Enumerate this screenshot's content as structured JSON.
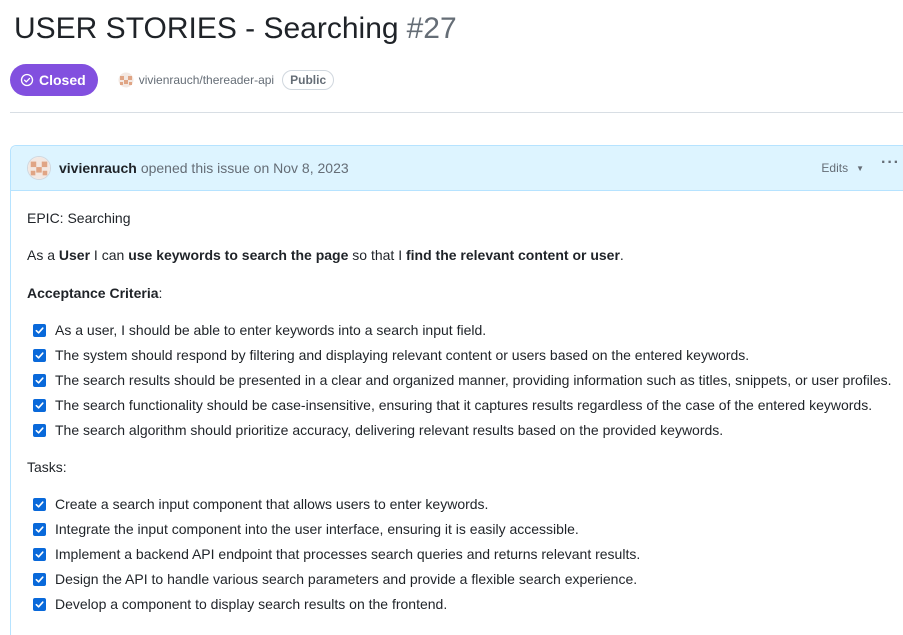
{
  "issue": {
    "title": "USER STORIES - Searching",
    "number": "#27",
    "state_label": "Closed",
    "repo": "vivienrauch/thereader-api",
    "visibility": "Public"
  },
  "comment": {
    "author": "vivienrauch",
    "opened_text": "opened this issue on Nov 8, 2023",
    "edits_label": "Edits",
    "more_label": "···",
    "epic": "EPIC: Searching",
    "story": {
      "p1": "As a ",
      "role": "User",
      "p2": " I can ",
      "action": "use keywords to search the page",
      "p3": " so that I ",
      "benefit": "find the relevant content or user",
      "p4": "."
    },
    "acceptance_heading": "Acceptance Criteria",
    "acceptance_colon": ":",
    "acceptance": [
      "As a user, I should be able to enter keywords into a search input field.",
      "The system should respond by filtering and displaying relevant content or users based on the entered keywords.",
      "The search results should be presented in a clear and organized manner, providing information such as titles, snippets, or user profiles.",
      "The search functionality should be case-insensitive, ensuring that it captures results regardless of the case of the entered keywords.",
      "The search algorithm should prioritize accuracy, delivering relevant results based on the provided keywords."
    ],
    "tasks_heading": "Tasks:",
    "tasks": [
      "Create a search input component that allows users to enter keywords.",
      "Integrate the input component into the user interface, ensuring it is easily accessible.",
      "Implement a backend API endpoint that processes search queries and returns relevant results.",
      "Design the API to handle various search parameters and provide a flexible search experience.",
      "Develop a component to display search results on the frontend."
    ]
  },
  "colors": {
    "closed": "#8250df",
    "checkbox": "#0969da",
    "header_bg": "#ddf4ff"
  }
}
